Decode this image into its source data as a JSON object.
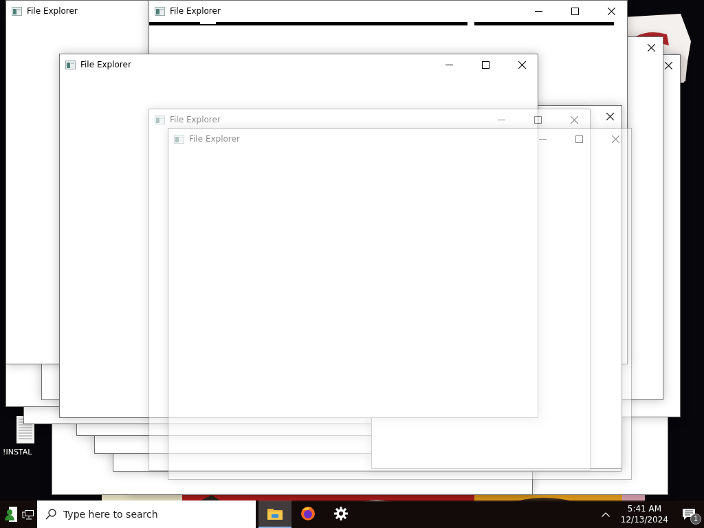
{
  "desktop": {
    "icons": [
      {
        "label": "!INSTAL"
      }
    ]
  },
  "windows": [
    {
      "kind": "blank"
    },
    {
      "kind": "blank"
    },
    {
      "kind": "blank"
    },
    {
      "kind": "blank"
    },
    {
      "kind": "blank"
    },
    {
      "kind": "blank"
    },
    {
      "kind": "blank"
    },
    {
      "kind": "blank"
    },
    {
      "kind": "title-only",
      "title": "File Explorer"
    },
    {
      "kind": "close-only"
    },
    {
      "kind": "close-only"
    },
    {
      "kind": "full-strips",
      "title": "File Explorer"
    },
    {
      "kind": "close-only"
    },
    {
      "kind": "full",
      "title": "File Explorer"
    },
    {
      "kind": "ghost",
      "title": "File Explorer"
    },
    {
      "kind": "ghost",
      "title": "File Explorer"
    }
  ],
  "taskbar": {
    "search": {
      "placeholder": "Type here to search"
    },
    "apps": [
      {
        "kind": "explorer",
        "selected": true
      },
      {
        "kind": "firefox",
        "selected": false
      },
      {
        "kind": "settings",
        "selected": false
      }
    ],
    "time": "5:41 AM",
    "date": "12/13/2024",
    "notifications": "1"
  }
}
